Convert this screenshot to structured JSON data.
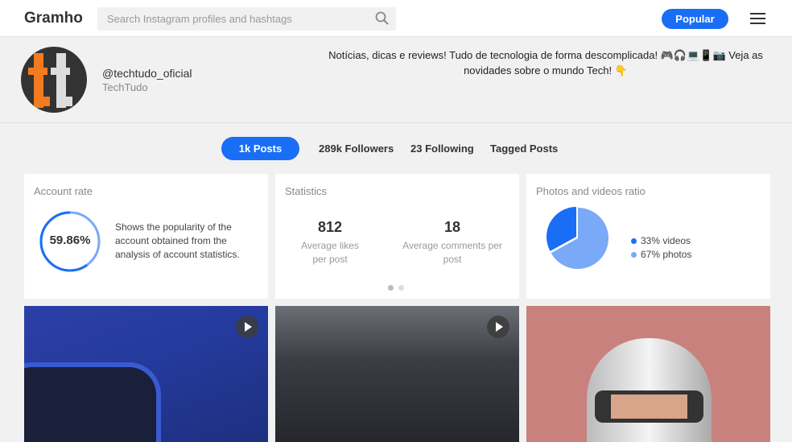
{
  "header": {
    "logo": "Gramho",
    "search_placeholder": "Search Instagram profiles and hashtags",
    "popular": "Popular"
  },
  "profile": {
    "handle": "@techtudo_oficial",
    "name": "TechTudo",
    "bio": "Notícias, dicas e reviews! Tudo de tecnologia de forma descomplicada! 🎮🎧💻📱📷 Veja as novidades sobre o mundo Tech! 👇"
  },
  "tabs": [
    {
      "label": "1k Posts"
    },
    {
      "label": "289k Followers"
    },
    {
      "label": "23 Following"
    },
    {
      "label": "Tagged Posts"
    }
  ],
  "account_rate": {
    "title": "Account rate",
    "value": "59.86%",
    "percent": 59.86,
    "description": "Shows the popularity of the account obtained from the analysis of account statistics."
  },
  "statistics": {
    "title": "Statistics",
    "likes": "812",
    "likes_label": "Average likes per post",
    "comments": "18",
    "comments_label": "Average comments per post"
  },
  "ratio": {
    "title": "Photos and videos ratio",
    "videos_pct": 33,
    "photos_pct": 67,
    "videos_label": "33% videos",
    "photos_label": "67% photos",
    "videos_color": "#1a6ef5",
    "photos_color": "#7aa9f7"
  }
}
